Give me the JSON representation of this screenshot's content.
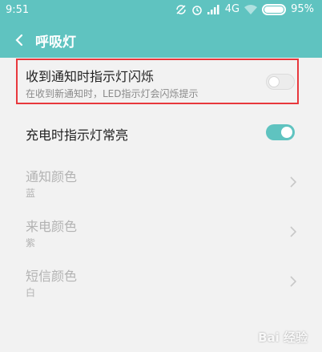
{
  "status_bar": {
    "time": "9:51",
    "network": "4G",
    "battery": "95%"
  },
  "header": {
    "title": "呼吸灯"
  },
  "settings": {
    "notify_blink": {
      "title": "收到通知时指示灯闪烁",
      "subtitle": "在收到新通知时，LED指示灯会闪烁提示",
      "enabled": false
    },
    "charging_light": {
      "title": "充电时指示灯常亮",
      "enabled": true
    },
    "notification_color": {
      "title": "通知颜色",
      "value": "蓝"
    },
    "call_color": {
      "title": "来电颜色",
      "value": "紫"
    },
    "sms_color": {
      "title": "短信颜色",
      "value": "白"
    }
  },
  "watermark": "Bai 经验",
  "colors": {
    "accent": "#5fc3c0",
    "highlight": "#e8383d"
  }
}
